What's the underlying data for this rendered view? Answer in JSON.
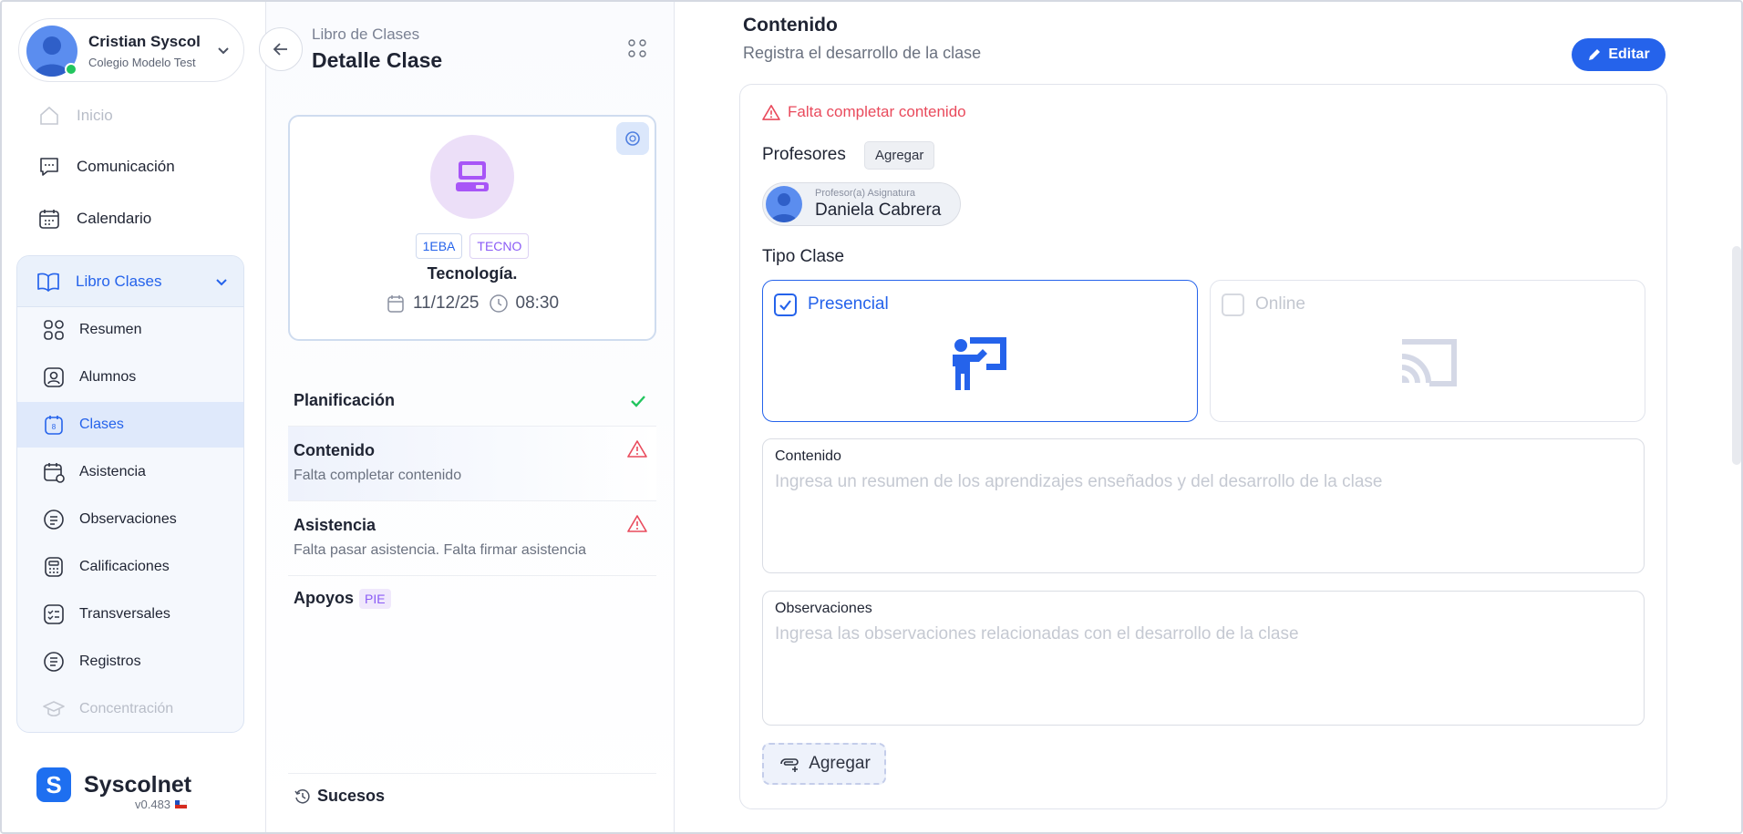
{
  "user": {
    "name": "Cristian Syscol",
    "school": "Colegio Modelo Test"
  },
  "nav": [
    {
      "label": "Inicio"
    },
    {
      "label": "Comunicación"
    },
    {
      "label": "Calendario"
    }
  ],
  "libro": {
    "label": "Libro Clases",
    "items": [
      {
        "label": "Resumen"
      },
      {
        "label": "Alumnos"
      },
      {
        "label": "Clases"
      },
      {
        "label": "Asistencia"
      },
      {
        "label": "Observaciones"
      },
      {
        "label": "Calificaciones"
      },
      {
        "label": "Transversales"
      },
      {
        "label": "Registros"
      },
      {
        "label": "Concentración"
      }
    ]
  },
  "brand": {
    "name": "Syscolnet",
    "version": "v0.483",
    "logo_letter": "S"
  },
  "detail": {
    "breadcrumb": "Libro de Clases",
    "title": "Detalle Clase",
    "course_tag": "1EBA",
    "subject_tag": "TECNO",
    "class_name": "Tecnología.",
    "date": "11/12/25",
    "time": "08:30"
  },
  "steps": [
    {
      "title": "Planificación",
      "subtitle": "",
      "status": "complete"
    },
    {
      "title": "Contenido",
      "subtitle": "Falta completar contenido",
      "status": "warning"
    },
    {
      "title": "Asistencia",
      "subtitle": "Falta pasar asistencia. Falta firmar asistencia",
      "status": "warning"
    },
    {
      "title": "Apoyos",
      "subtitle": "",
      "badge": "PIE"
    }
  ],
  "sucesos": "Sucesos",
  "content": {
    "title": "Contenido",
    "subtitle": "Registra el desarrollo de la clase",
    "edit_label": "Editar",
    "warning": "Falta completar contenido",
    "profesores_label": "Profesores",
    "agregar_label": "Agregar",
    "professor": {
      "role": "Profesor(a) Asignatura",
      "name": "Daniela Cabrera"
    },
    "tipo_label": "Tipo Clase",
    "tipo_options": [
      {
        "label": "Presencial",
        "checked": true
      },
      {
        "label": "Online",
        "checked": false
      }
    ],
    "contenido_field": {
      "label": "Contenido",
      "value": "",
      "placeholder": "Ingresa un resumen de los aprendizajes enseñados y del desarrollo de la clase"
    },
    "observaciones_field": {
      "label": "Observaciones",
      "value": "",
      "placeholder": "Ingresa las observaciones relacionadas con el desarrollo de la clase"
    },
    "add_button": "Agregar"
  },
  "colors": {
    "accent": "#2563eb",
    "warning": "#e94a5c",
    "success": "#22c55e",
    "purple": "#8b5cf6"
  }
}
